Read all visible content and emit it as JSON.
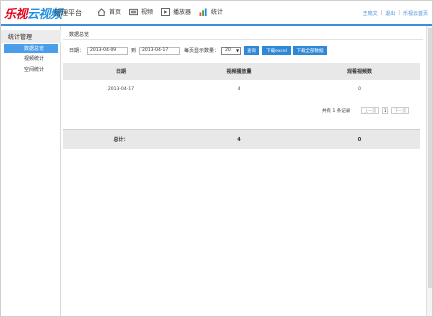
{
  "header": {
    "logo_red": "乐视",
    "logo_blue": "云视频",
    "platform": "管理平台",
    "nav": [
      {
        "label": "首页",
        "icon": "home-icon"
      },
      {
        "label": "视频",
        "icon": "video-icon"
      },
      {
        "label": "播放器",
        "icon": "player-icon"
      },
      {
        "label": "统计",
        "icon": "chart-icon"
      }
    ],
    "links": [
      "王晓文",
      "退出",
      "乐视云首页"
    ]
  },
  "sidebar": {
    "title": "统计管理",
    "items": [
      {
        "label": "数据总览",
        "active": true
      },
      {
        "label": "视频统计",
        "active": false
      },
      {
        "label": "空间统计",
        "active": false
      }
    ]
  },
  "main": {
    "crumb": "数据总览",
    "filters": {
      "date_label": "日期：",
      "start_date": "2013-04-09",
      "to_label": "到",
      "end_date": "2013-04-17",
      "page_size_label": "每页显示数量：",
      "page_size": "20",
      "query_btn": "查询",
      "download_excel_btn": "下载excel",
      "download_all_btn": "下载全部数据"
    },
    "table": {
      "headers": [
        "日期",
        "视频播放量",
        "观看视频数"
      ],
      "rows": [
        [
          "2013-04-17",
          "4",
          "0"
        ]
      ]
    },
    "pager": {
      "total_prefix": "共有",
      "total": "1",
      "total_suffix": "条记录",
      "prev": "上一页",
      "current": "1",
      "next": "下一页"
    },
    "summary": {
      "label": "总计：",
      "plays": "4",
      "views": "0"
    }
  },
  "colors": {
    "accent": "#2f87d8",
    "logo_red": "#e4001b",
    "logo_blue": "#1d8fe0"
  }
}
